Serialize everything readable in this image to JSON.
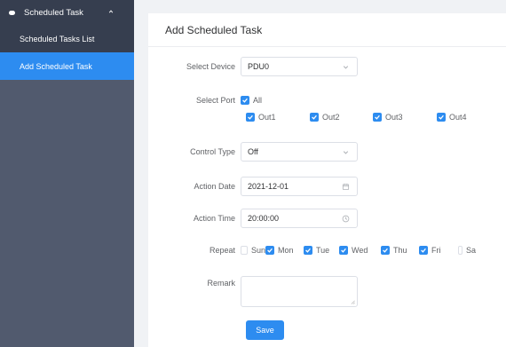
{
  "sidebar": {
    "group_label": "Scheduled Task",
    "items": [
      {
        "label": "Scheduled Tasks List"
      },
      {
        "label": "Add Scheduled Task"
      }
    ]
  },
  "form": {
    "title": "Add Scheduled Task",
    "device": {
      "label": "Select Device",
      "value": "PDU0"
    },
    "port": {
      "label": "Select Port",
      "all_label": "All",
      "outputs": [
        "Out1",
        "Out2",
        "Out3",
        "Out4"
      ]
    },
    "control_type": {
      "label": "Control Type",
      "value": "Off"
    },
    "action_date": {
      "label": "Action Date",
      "value": "2021-12-01"
    },
    "action_time": {
      "label": "Action Time",
      "value": "20:00:00"
    },
    "repeat": {
      "label": "Repeat",
      "days": [
        {
          "label": "Sun",
          "checked": false
        },
        {
          "label": "Mon",
          "checked": true
        },
        {
          "label": "Tue",
          "checked": true
        },
        {
          "label": "Wed",
          "checked": true
        },
        {
          "label": "Thu",
          "checked": true
        },
        {
          "label": "Fri",
          "checked": true
        },
        {
          "label": "Sa",
          "checked": false
        }
      ]
    },
    "remark": {
      "label": "Remark",
      "value": ""
    },
    "save_label": "Save"
  },
  "colors": {
    "accent": "#2d8cf0",
    "sidebar_bg": "#515a6e",
    "sidebar_dark": "#363e4f"
  }
}
